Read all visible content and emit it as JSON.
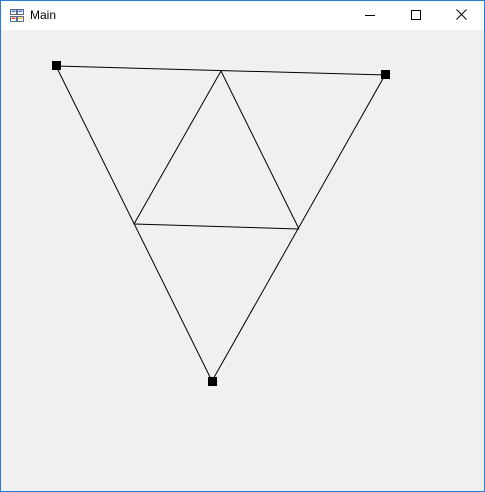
{
  "window": {
    "title": "Main"
  },
  "icons": {
    "app": "app-icon",
    "minimize": "minimize-icon",
    "maximize": "maximize-icon",
    "close": "close-icon"
  },
  "colors": {
    "titlebar": "#ffffff",
    "client_background": "#f0f0f0",
    "window_border": "#2b79d6",
    "line": "#000000",
    "handle": "#000000"
  }
}
